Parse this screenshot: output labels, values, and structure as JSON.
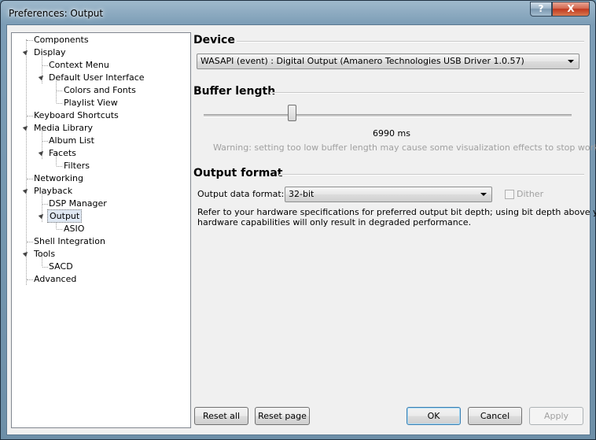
{
  "window": {
    "title": "Preferences: Output",
    "help_glyph": "?",
    "close_glyph": "X"
  },
  "tree": {
    "items": [
      "Components",
      "Display",
      "Context Menu",
      "Default User Interface",
      "Colors and Fonts",
      "Playlist View",
      "Keyboard Shortcuts",
      "Media Library",
      "Album List",
      "Facets",
      "Filters",
      "Networking",
      "Playback",
      "DSP Manager",
      "Output",
      "ASIO",
      "Shell Integration",
      "Tools",
      "SACD",
      "Advanced"
    ],
    "selected": "Output"
  },
  "device": {
    "title": "Device",
    "selected": "WASAPI (event) : Digital Output (Amanero Technologies USB Driver 1.0.57)"
  },
  "buffer": {
    "title": "Buffer length",
    "value_text": "6990 ms",
    "slider_fraction": 0.24,
    "warning": "Warning: setting too low buffer length may cause some visualization effects to stop working."
  },
  "output_format": {
    "title": "Output format",
    "label": "Output data format:",
    "selected": "32-bit",
    "dither_label": "Dither",
    "dither_checked": false,
    "note_line1": "Refer to your hardware specifications for preferred output bit depth; using bit depth above your",
    "note_line2": "hardware capabilities will only result in degraded performance."
  },
  "buttons": {
    "reset_all": "Reset all",
    "reset_page": "Reset page",
    "ok": "OK",
    "cancel": "Cancel",
    "apply": "Apply"
  }
}
